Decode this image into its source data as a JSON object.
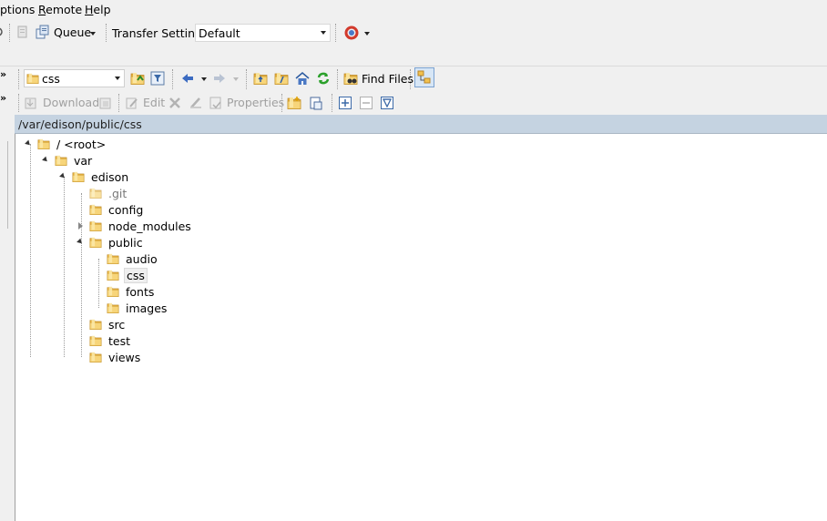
{
  "menubar": {
    "options": "ptions",
    "remote": "Remote",
    "help": "Help"
  },
  "toolbar1": {
    "queue_label": "Queue",
    "transfer_settings_label": "Transfer Settings",
    "transfer_settings_value": "Default"
  },
  "toolbar2": {
    "dir_combo_value": "css",
    "find_files_label": "Find Files"
  },
  "toolbar3": {
    "download_label": "Download",
    "edit_label": "Edit",
    "properties_label": "Properties"
  },
  "path": "/var/edison/public/css",
  "tree": {
    "root": "/ <root>",
    "var": "var",
    "edison": "edison",
    "git": ".git",
    "config": "config",
    "node_modules": "node_modules",
    "public": "public",
    "audio": "audio",
    "css": "css",
    "fonts": "fonts",
    "images": "images",
    "src": "src",
    "test": "test",
    "views": "views"
  },
  "colors": {
    "path_bar": "#c5d3e1",
    "folder": "#f2c14e",
    "toolbar_bg": "#f0f0f0"
  }
}
